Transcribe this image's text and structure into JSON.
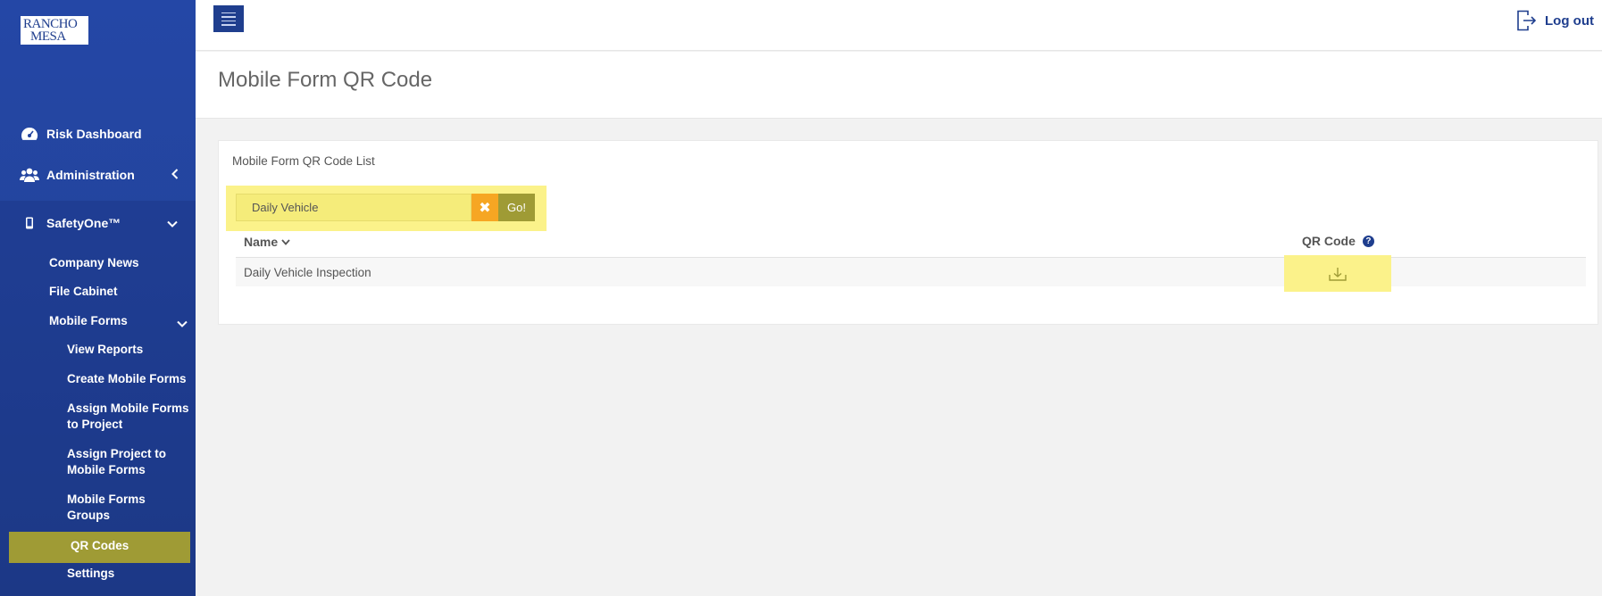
{
  "logo": {
    "line1": "RANCHO",
    "line2": "MESA"
  },
  "sidebar": {
    "risk_dashboard": "Risk Dashboard",
    "administration": "Administration",
    "safetyone": "SafetyOne™",
    "company_news": "Company News",
    "file_cabinet": "File Cabinet",
    "mobile_forms": "Mobile Forms",
    "view_reports": "View Reports",
    "create_mobile_forms": "Create Mobile Forms",
    "assign_forms_l1": "Assign Mobile Forms",
    "assign_forms_l2": "to Project",
    "assign_project_l1": "Assign Project to",
    "assign_project_l2": "Mobile Forms",
    "groups_l1": "Mobile Forms",
    "groups_l2": "Groups",
    "qr_codes": "QR Codes",
    "settings": "Settings"
  },
  "topbar": {
    "logout": "Log out"
  },
  "page": {
    "title": "Mobile Form QR Code"
  },
  "card": {
    "title": "Mobile Form QR Code List",
    "search_value": "Daily Vehicle",
    "clear_icon": "✖",
    "go_label": "Go!",
    "columns": {
      "name": "Name",
      "qr": "QR Code",
      "help": "?"
    },
    "rows": [
      {
        "name": "Daily Vehicle Inspection"
      }
    ]
  },
  "colors": {
    "sidebar": "#23449d",
    "highlight": "#fbf28a",
    "active": "#9f9b35",
    "clear": "#f6a623"
  }
}
